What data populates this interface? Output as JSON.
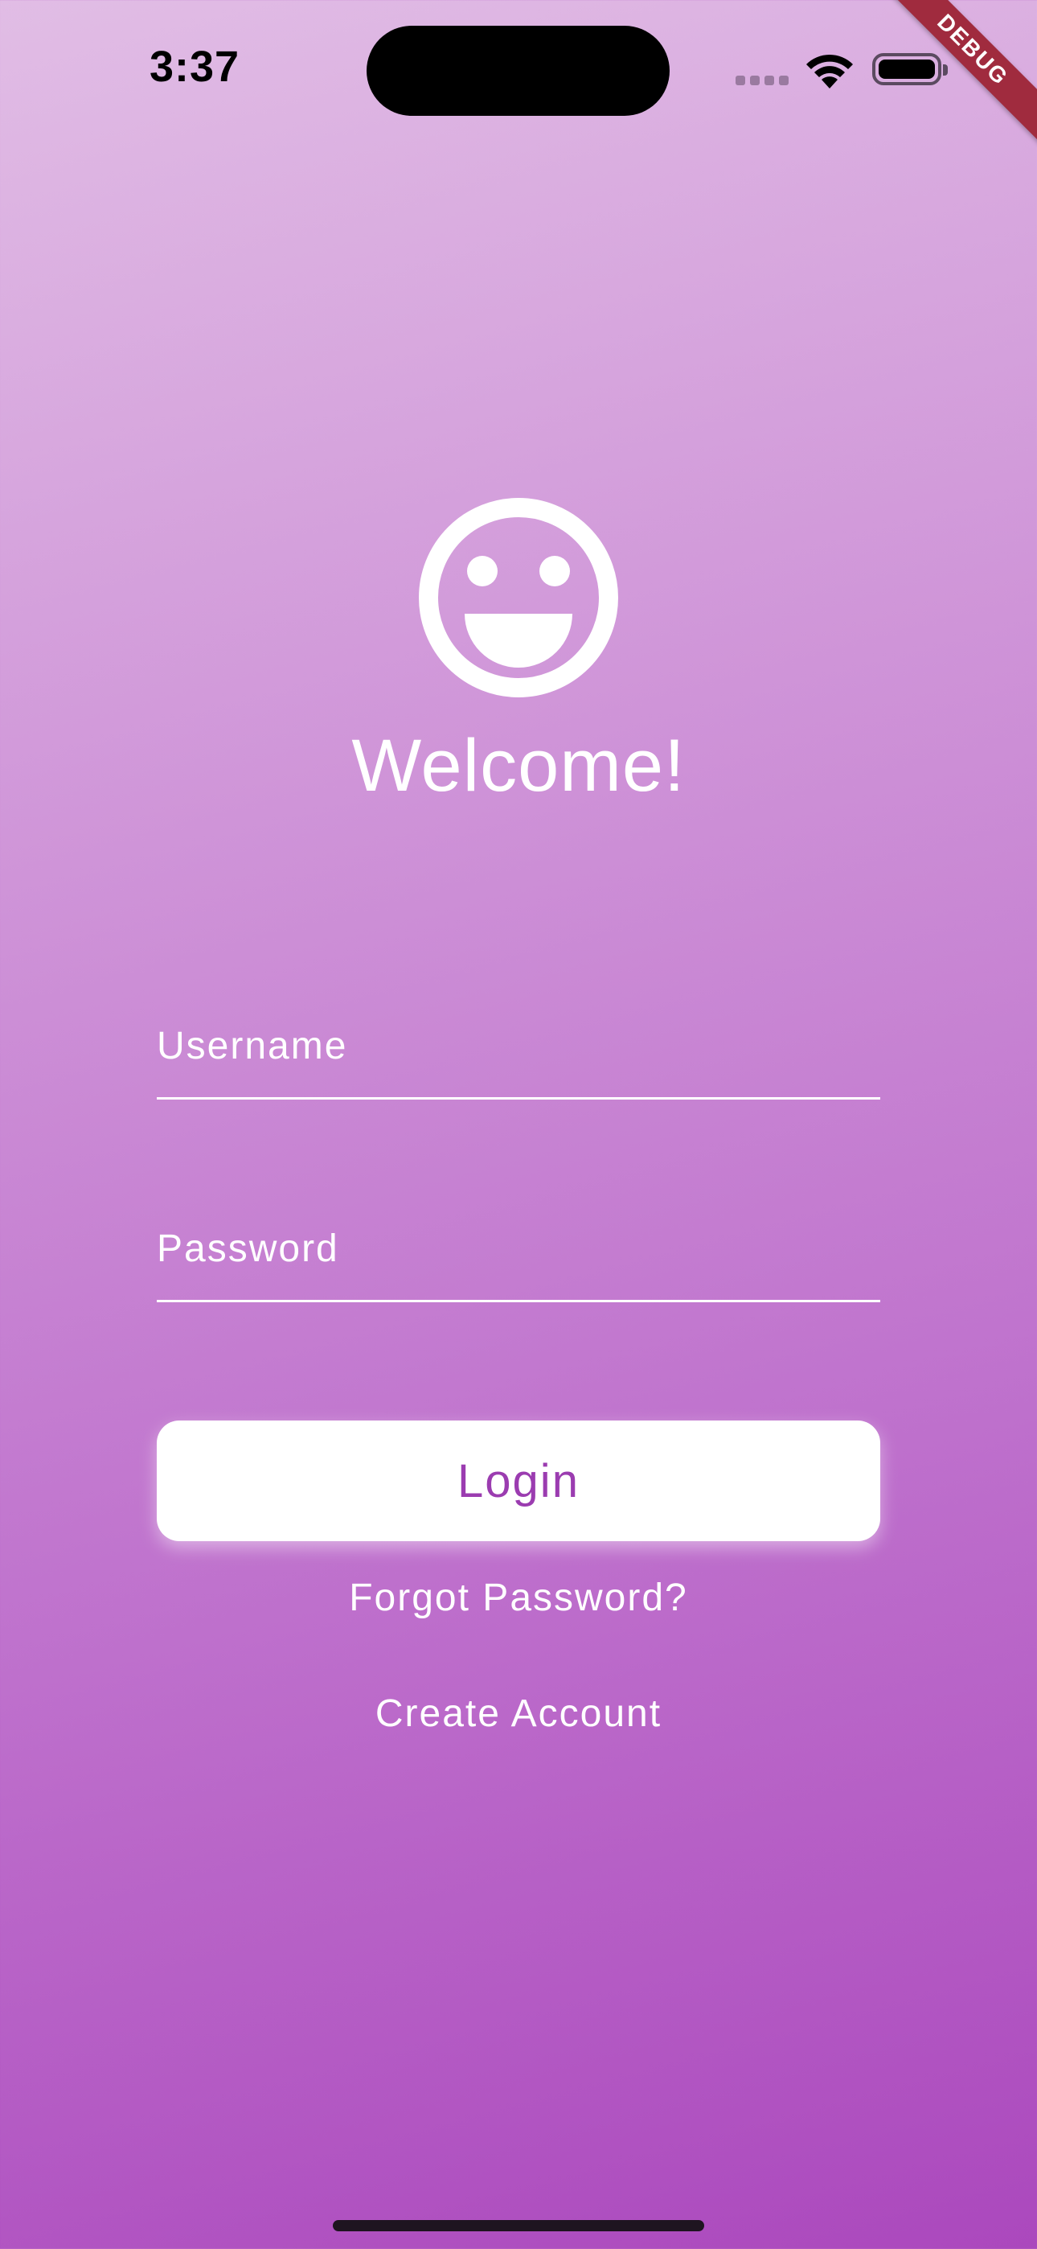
{
  "status_bar": {
    "time": "3:37"
  },
  "debug_banner": {
    "label": "DEBUG"
  },
  "header": {
    "icon": "smiley-face-icon",
    "title": "Welcome!"
  },
  "form": {
    "username_placeholder": "Username",
    "username_value": "",
    "password_placeholder": "Password",
    "password_value": ""
  },
  "actions": {
    "login_label": "Login",
    "forgot_label": "Forgot Password?",
    "create_label": "Create Account"
  },
  "colors": {
    "gradient_start": "#e1bde5",
    "gradient_end": "#ab48bd",
    "login_text": "#9b3cb0",
    "debug_banner": "#a02b3e"
  }
}
